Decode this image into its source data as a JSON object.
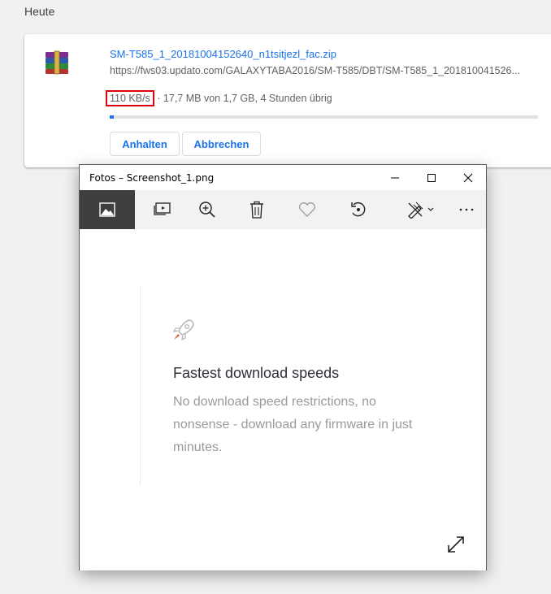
{
  "section": {
    "title": "Heute"
  },
  "download": {
    "icon": "winrar-archive-icon",
    "file_name": "SM-T585_1_20181004152640_n1tsitjezl_fac.zip",
    "url": "https://fws03.updato.com/GALAXYTABA2016/SM-T585/DBT/SM-T585_1_201810041526...",
    "speed": "110 KB/s",
    "status_rest": "· 17,7 MB von 1,7 GB, 4 Stunden übrig",
    "progress": 0.01,
    "buttons": {
      "pause": "Anhalten",
      "cancel": "Abbrechen"
    },
    "colors": {
      "link": "#1a73e8",
      "progress": "#1a73e8",
      "highlight": "#e0000b"
    }
  },
  "photos_window": {
    "title": "Fotos – Screenshot_1.png",
    "caption_buttons": [
      "minimize-icon",
      "maximize-icon",
      "close-icon"
    ],
    "toolbar": [
      "image-icon",
      "slideshow-icon",
      "zoom-in-icon",
      "delete-icon",
      "favorite-icon",
      "rotate-icon",
      "edit-icon",
      "more-icon"
    ],
    "content": {
      "icon": "rocket-icon",
      "heading": "Fastest download speeds",
      "description": "No download speed restrictions, no nonsense - download any firmware in just minutes."
    }
  }
}
